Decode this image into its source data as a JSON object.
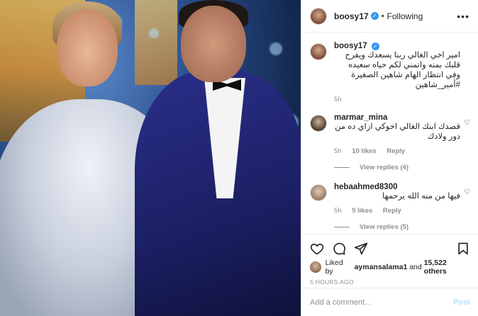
{
  "header": {
    "username": "boosy17",
    "separator": "•",
    "follow_status": "Following",
    "more_label": "•••"
  },
  "caption": {
    "username": "boosy17",
    "text": "امير اخي الغالي ربنا يسعدك ويفرح قلبك بمنه واتمني لكم حياه سعيده وفي انتظار الهام شاهين الصغيرة #أمير_شاهين",
    "time": "5h"
  },
  "comments": [
    {
      "username": "marmar_mina",
      "text": "قصدك ابنك الغالي اخوكي ازاي ده من دور ولادك",
      "time": "5h",
      "likes": "10 likes",
      "reply_label": "Reply",
      "view_replies": "View replies (4)"
    },
    {
      "username": "hebaahmed8300",
      "text": "فيها من منه الله يرحمها",
      "time": "5h",
      "likes": "5 likes",
      "reply_label": "Reply",
      "view_replies": "View replies (5)"
    }
  ],
  "likes_line": {
    "prefix": "Liked by",
    "user": "aymansalama1",
    "middle": "and",
    "others": "15,522 others"
  },
  "post_time": "5 HOURS AGO",
  "add_comment": {
    "placeholder": "Add a comment...",
    "post_label": "Post"
  },
  "icons": {
    "like": "heart-icon",
    "comment": "comment-icon",
    "share": "share-icon",
    "save": "bookmark-icon"
  },
  "colors": {
    "verified": "#3897f0",
    "post_button": "#b2dffc",
    "secondary_text": "#8e8e8e"
  }
}
